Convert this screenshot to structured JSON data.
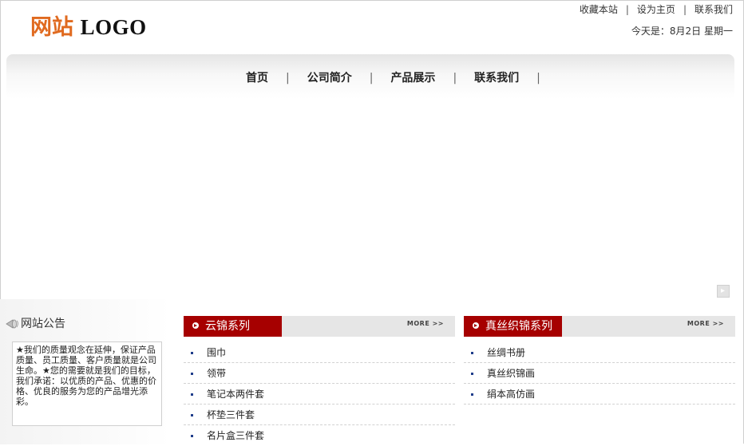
{
  "header": {
    "logo_cn": "网站",
    "logo_en": "LOGO",
    "links": [
      "收藏本站",
      "设为主页",
      "联系我们"
    ],
    "separator": "|",
    "date_text": "今天是：8月2日 星期一"
  },
  "nav": {
    "items": [
      "首页",
      "公司简介",
      "产品展示",
      "联系我们"
    ],
    "separator": "|"
  },
  "notice": {
    "title": "网站公告",
    "text": "★我们的质量观念在延伸，保证产品质量、员工质量、客户质量就是公司生命。★您的需要就是我们的目标，我们承诺：以优质的产品、优惠的价格、优良的服务为您的产品增光添彩。"
  },
  "products": [
    {
      "title": "云锦系列",
      "more": "MORE >>",
      "items": [
        "围巾",
        "领带",
        "笔记本两件套",
        "杯垫三件套",
        "名片盒三件套"
      ]
    },
    {
      "title": "真丝织锦系列",
      "more": "MORE >>",
      "items": [
        "丝绸书册",
        "真丝织锦画",
        "绢本高仿画"
      ]
    }
  ],
  "colors": {
    "logo_accent": "#e06a1f",
    "section_red": "#a60000",
    "bullet_blue": "#1f3d8a"
  }
}
